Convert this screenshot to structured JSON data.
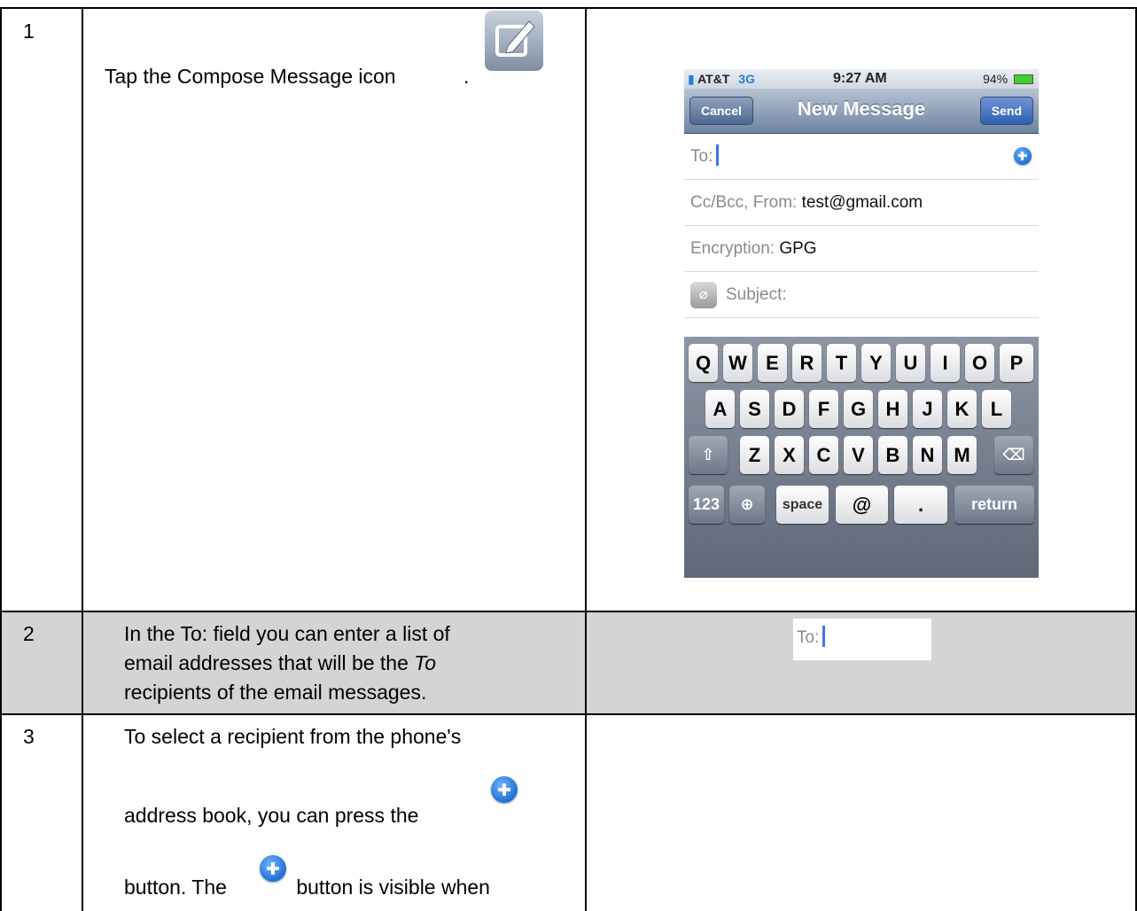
{
  "rows": [
    {
      "num": "1",
      "text_before_icon": "Tap the Compose Message icon",
      "text_after_icon": "."
    },
    {
      "num": "2",
      "line1": "In the To: field you can enter a list of",
      "line2_before": "email addresses that will be the ",
      "line2_italic": "To",
      "line3": "recipients of the email messages."
    },
    {
      "num": "3",
      "line1": "To select a recipient from the phone's",
      "line2": "address book, you can press the",
      "line3_before": "button.  The",
      "line3_after": "button is visible when"
    }
  ],
  "phone": {
    "status": {
      "carrier": "AT&T",
      "network": "3G",
      "time": "9:27 AM",
      "battery": "94%"
    },
    "nav": {
      "cancel": "Cancel",
      "title": "New Message",
      "send": "Send"
    },
    "fields": {
      "to_label": "To:",
      "ccbcc_label": "Cc/Bcc, From:",
      "ccbcc_value": "test@gmail.com",
      "encryption_label": "Encryption:",
      "encryption_value": "GPG",
      "subject_label": "Subject:"
    },
    "keyboard": {
      "row1": [
        "Q",
        "W",
        "E",
        "R",
        "T",
        "Y",
        "U",
        "I",
        "O",
        "P"
      ],
      "row2": [
        "A",
        "S",
        "D",
        "F",
        "G",
        "H",
        "J",
        "K",
        "L"
      ],
      "row3": [
        "Z",
        "X",
        "C",
        "V",
        "B",
        "N",
        "M"
      ],
      "num_key": "123",
      "space_key": "space",
      "at_key": "@",
      "dot_key": ".",
      "return_key": "return"
    }
  },
  "row2_snippet": {
    "to_label": "To:"
  },
  "icons": {
    "compose": "compose-icon",
    "add_contact": "plus-circle-icon"
  }
}
